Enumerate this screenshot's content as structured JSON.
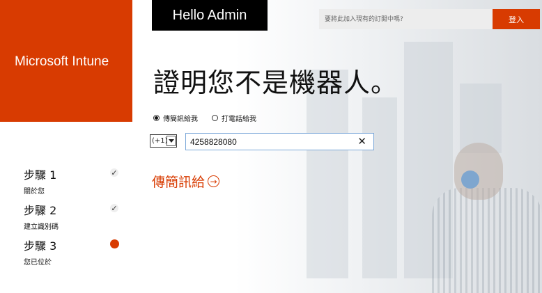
{
  "brand": {
    "title": "Microsoft Intune",
    "color": "#d83b01"
  },
  "greeting": "Hello Admin",
  "header": {
    "join_placeholder": "要將此加入現有的訂閱中嗎?",
    "signin_label": "登入"
  },
  "page": {
    "headline": "證明您不是機器人。"
  },
  "verify": {
    "options": [
      {
        "label": "傳簡訊給我",
        "selected": true
      },
      {
        "label": "打電話給我",
        "selected": false
      }
    ],
    "country_code": "(+1)",
    "phone_value": "4258828080",
    "send_label": "傳簡訊給"
  },
  "steps": [
    {
      "title": "步驟 1",
      "subtitle": "關於您",
      "status": "done"
    },
    {
      "title": "步驟 2",
      "subtitle": "建立識別碼",
      "status": "done"
    },
    {
      "title": "步驟 3",
      "subtitle": "您已位於",
      "status": "current"
    }
  ],
  "icons": {
    "check": "check-icon",
    "clear": "close-icon",
    "arrow": "arrow-right-circle-icon",
    "current": "current-step-dot-icon"
  }
}
